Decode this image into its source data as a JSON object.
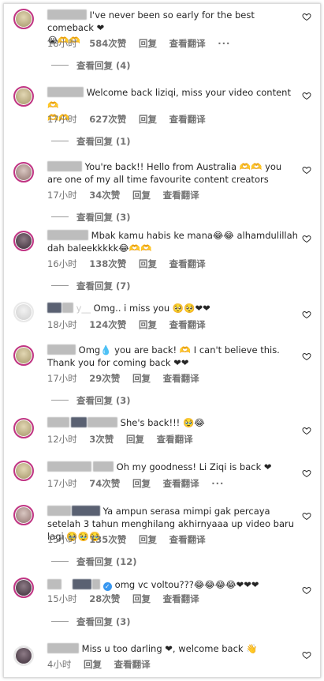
{
  "comments": [
    {
      "user": "...as",
      "text": "I've never been so early for the best comeback ❤",
      "text2": "😭🫶🫶",
      "time": "18小时",
      "likes": "584次赞",
      "reply": "回复",
      "translate": "查看翻译",
      "more": "···",
      "replies": "查看回复 (4)"
    },
    {
      "user": "...",
      "text": "Welcome back liziqi, miss your video content 🫶",
      "text2": "🫶🫶",
      "time": "17小时",
      "likes": "627次赞",
      "reply": "回复",
      "translate": "查看翻译",
      "replies": "查看回复 (1)"
    },
    {
      "user": "...",
      "text": "You're back!! Hello from Australia 🫶🫶 you are one of my all time favourite content creators",
      "time": "17小时",
      "likes": "34次赞",
      "reply": "回复",
      "translate": "查看翻译",
      "replies": "查看回复 (3)"
    },
    {
      "user": "...h",
      "text": "Mbak kamu habis ke mana😂😂 alhamdulillah dah baleekkkkk😂🫶🫶",
      "time": "16小时",
      "likes": "138次赞",
      "reply": "回复",
      "translate": "查看翻译",
      "replies": "查看回复 (7)"
    },
    {
      "user": "y__",
      "text": "Omg.. i miss you 🥺🥺❤❤",
      "time": "18小时",
      "likes": "124次赞",
      "reply": "回复",
      "translate": "查看翻译"
    },
    {
      "user": "...a",
      "text": "Omg💧 you are back! 🫶 I can't believe this. Thank you for coming back ❤❤",
      "time": "17小时",
      "likes": "29次赞",
      "reply": "回复",
      "translate": "查看翻译",
      "replies": "查看回复 (3)"
    },
    {
      "user": "...",
      "text": "She's back!!! 🥹😂",
      "time": "12小时",
      "likes": "3次赞",
      "reply": "回复",
      "translate": "查看翻译"
    },
    {
      "user": "...at_",
      "text": "Oh my goodness! Li Ziqi is back ❤",
      "time": "17小时",
      "likes": "74次赞",
      "reply": "回复",
      "translate": "查看翻译",
      "more": "···"
    },
    {
      "user": "...",
      "text": "Ya ampun serasa mimpi gak percaya setelah 3 tahun menghilang akhirnyaaa up video baru lagi 🥹🥹🥹",
      "time": "15小时",
      "likes": "135次赞",
      "reply": "回复",
      "translate": "查看翻译",
      "replies": "查看回复 (12)"
    },
    {
      "user": "...",
      "text": "omg vc voltou???😂😂😂😂❤❤❤",
      "time": "15小时",
      "likes": "28次赞",
      "reply": "回复",
      "translate": "查看翻译",
      "replies": "查看回复 (3)"
    },
    {
      "user": "..._",
      "text": "Miss u too darling ❤, welcome back 👋",
      "time": "4小时",
      "reply": "回复",
      "translate": "查看翻译"
    }
  ],
  "colors": {
    "text": "#262626",
    "meta": "#737373",
    "story_ring": "#c13584",
    "verified": "#3897f0"
  },
  "icons": {
    "like": "heart-outline-icon",
    "verified": "verified-badge-icon"
  }
}
